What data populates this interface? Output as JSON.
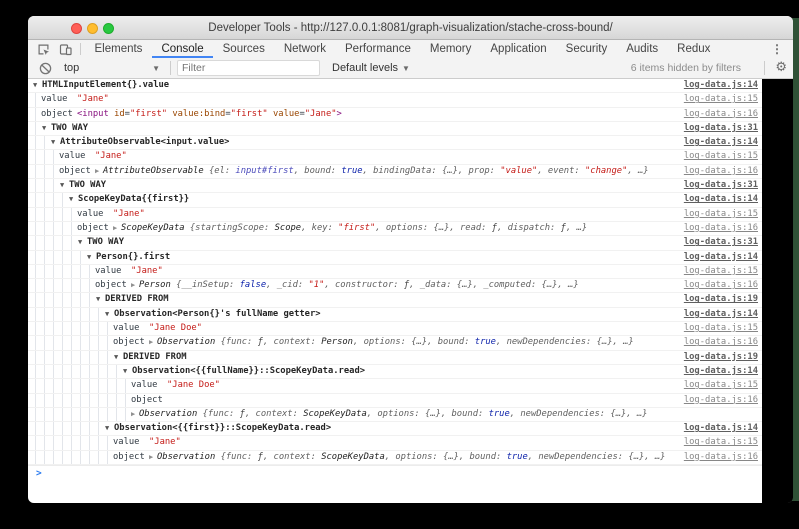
{
  "window": {
    "title": "Developer Tools - http://127.0.0.1:8081/graph-visualization/stache-cross-bound/"
  },
  "tabs": {
    "items": [
      "Elements",
      "Console",
      "Sources",
      "Network",
      "Performance",
      "Memory",
      "Application",
      "Security",
      "Audits",
      "Redux"
    ],
    "selected": "Console"
  },
  "toolbar": {
    "context_selector": "top",
    "filter_placeholder": "Filter",
    "levels_label": "Default levels",
    "hidden_info": "6 items hidden by filters"
  },
  "colors": {
    "accent_blue": "#4285f4",
    "string_red": "#c41a16",
    "boolean_blue": "#0d22aa",
    "tag_purple": "#881280",
    "attr_orange": "#994500",
    "element_ref_blue": "#4b4bbb",
    "edge_green": "#2f5136"
  },
  "console": {
    "prompt_symbol": ">",
    "rows": [
      {
        "level": 0,
        "type": "group",
        "segs": [
          {
            "t": "HTMLInputElement{}.value",
            "c": "g"
          }
        ],
        "link": "log-data.js:14"
      },
      {
        "level": 1,
        "type": "kv",
        "label": "value",
        "segs": [
          {
            "t": "\"Jane\"",
            "c": "str"
          }
        ],
        "link": "log-data.js:15"
      },
      {
        "level": 1,
        "type": "kv",
        "label": "object",
        "segs": [
          {
            "t": "<input ",
            "c": "tag"
          },
          {
            "t": "id",
            "c": "attr"
          },
          {
            "t": "=",
            "c": "p"
          },
          {
            "t": "\"first\"",
            "c": "aval"
          },
          {
            "t": " ",
            "c": "p"
          },
          {
            "t": "value:bind",
            "c": "attr"
          },
          {
            "t": "=",
            "c": "p"
          },
          {
            "t": "\"first\"",
            "c": "aval"
          },
          {
            "t": " ",
            "c": "p"
          },
          {
            "t": "value",
            "c": "attr"
          },
          {
            "t": "=",
            "c": "p"
          },
          {
            "t": "\"Jane\"",
            "c": "aval"
          },
          {
            "t": ">",
            "c": "tag"
          }
        ],
        "link": "log-data.js:16"
      },
      {
        "level": 1,
        "type": "group",
        "segs": [
          {
            "t": "TWO WAY",
            "c": "g"
          }
        ],
        "link": "log-data.js:31"
      },
      {
        "level": 2,
        "type": "group",
        "segs": [
          {
            "t": "AttributeObservable<input.value>",
            "c": "g"
          }
        ],
        "link": "log-data.js:14"
      },
      {
        "level": 3,
        "type": "kv",
        "label": "value",
        "segs": [
          {
            "t": "\"Jane\"",
            "c": "str"
          }
        ],
        "link": "log-data.js:15"
      },
      {
        "level": 3,
        "type": "kv",
        "label": "object",
        "arrow": true,
        "segs": [
          {
            "t": "AttributeObservable ",
            "c": "obj"
          },
          {
            "t": "{el: ",
            "c": "prev"
          },
          {
            "t": "input#first",
            "c": "elref"
          },
          {
            "t": ", bound: ",
            "c": "prev"
          },
          {
            "t": "true",
            "c": "bool"
          },
          {
            "t": ", bindingData: {…}, prop: ",
            "c": "prev"
          },
          {
            "t": "\"value\"",
            "c": "istr"
          },
          {
            "t": ", event: ",
            "c": "prev"
          },
          {
            "t": "\"change\"",
            "c": "istr"
          },
          {
            "t": ", …}",
            "c": "prev"
          }
        ],
        "link": "log-data.js:16"
      },
      {
        "level": 3,
        "type": "group",
        "segs": [
          {
            "t": "TWO WAY",
            "c": "g"
          }
        ],
        "link": "log-data.js:31"
      },
      {
        "level": 4,
        "type": "group",
        "segs": [
          {
            "t": "ScopeKeyData{{first}}",
            "c": "g"
          }
        ],
        "link": "log-data.js:14"
      },
      {
        "level": 5,
        "type": "kv",
        "label": "value",
        "segs": [
          {
            "t": "\"Jane\"",
            "c": "str"
          }
        ],
        "link": "log-data.js:15"
      },
      {
        "level": 5,
        "type": "kv",
        "label": "object",
        "arrow": true,
        "segs": [
          {
            "t": "ScopeKeyData ",
            "c": "obj"
          },
          {
            "t": "{startingScope: ",
            "c": "prev"
          },
          {
            "t": "Scope",
            "c": "obj"
          },
          {
            "t": ", key: ",
            "c": "prev"
          },
          {
            "t": "\"first\"",
            "c": "istr"
          },
          {
            "t": ", options: {…}, read: ",
            "c": "prev"
          },
          {
            "t": "ƒ",
            "c": "fn"
          },
          {
            "t": ", dispatch: ",
            "c": "prev"
          },
          {
            "t": "ƒ",
            "c": "fn"
          },
          {
            "t": ", …}",
            "c": "prev"
          }
        ],
        "link": "log-data.js:16"
      },
      {
        "level": 5,
        "type": "group",
        "segs": [
          {
            "t": "TWO WAY",
            "c": "g"
          }
        ],
        "link": "log-data.js:31"
      },
      {
        "level": 6,
        "type": "group",
        "segs": [
          {
            "t": "Person{}.first",
            "c": "g"
          }
        ],
        "link": "log-data.js:14"
      },
      {
        "level": 7,
        "type": "kv",
        "label": "value",
        "segs": [
          {
            "t": "\"Jane\"",
            "c": "str"
          }
        ],
        "link": "log-data.js:15"
      },
      {
        "level": 7,
        "type": "kv",
        "label": "object",
        "arrow": true,
        "segs": [
          {
            "t": "Person ",
            "c": "obj"
          },
          {
            "t": "{__inSetup: ",
            "c": "prev"
          },
          {
            "t": "false",
            "c": "bool"
          },
          {
            "t": ", _cid: ",
            "c": "prev"
          },
          {
            "t": "\"1\"",
            "c": "istr"
          },
          {
            "t": ", constructor: ",
            "c": "prev"
          },
          {
            "t": "ƒ",
            "c": "fn"
          },
          {
            "t": ", _data: {…}, _computed: {…}, …}",
            "c": "prev"
          }
        ],
        "link": "log-data.js:16"
      },
      {
        "level": 7,
        "type": "group",
        "segs": [
          {
            "t": "DERIVED FROM",
            "c": "g"
          }
        ],
        "link": "log-data.js:19"
      },
      {
        "level": 8,
        "type": "group",
        "segs": [
          {
            "t": "Observation<Person{}'s fullName getter>",
            "c": "g"
          }
        ],
        "link": "log-data.js:14"
      },
      {
        "level": 9,
        "type": "kv",
        "label": "value",
        "segs": [
          {
            "t": "\"Jane Doe\"",
            "c": "str"
          }
        ],
        "link": "log-data.js:15"
      },
      {
        "level": 9,
        "type": "kv",
        "label": "object",
        "arrow": true,
        "segs": [
          {
            "t": "Observation ",
            "c": "obj"
          },
          {
            "t": "{func: ",
            "c": "prev"
          },
          {
            "t": "ƒ",
            "c": "fn"
          },
          {
            "t": ", context: ",
            "c": "prev"
          },
          {
            "t": "Person",
            "c": "obj"
          },
          {
            "t": ", options: {…}, bound: ",
            "c": "prev"
          },
          {
            "t": "true",
            "c": "bool"
          },
          {
            "t": ", newDependencies: {…}, …}",
            "c": "prev"
          }
        ],
        "link": "log-data.js:16"
      },
      {
        "level": 9,
        "type": "group",
        "segs": [
          {
            "t": "DERIVED FROM",
            "c": "g"
          }
        ],
        "link": "log-data.js:19"
      },
      {
        "level": 10,
        "type": "group",
        "segs": [
          {
            "t": "Observation<{{fullName}}::ScopeKeyData.read>",
            "c": "g"
          }
        ],
        "link": "log-data.js:14"
      },
      {
        "level": 11,
        "type": "kv",
        "label": "value",
        "segs": [
          {
            "t": "\"Jane Doe\"",
            "c": "str"
          }
        ],
        "link": "log-data.js:15"
      },
      {
        "level": 11,
        "type": "kv",
        "label": "object",
        "segs": [],
        "link": "log-data.js:16"
      },
      {
        "level": 11,
        "type": "cont",
        "arrow": true,
        "segs": [
          {
            "t": "Observation ",
            "c": "obj"
          },
          {
            "t": "{func: ",
            "c": "prev"
          },
          {
            "t": "ƒ",
            "c": "fn"
          },
          {
            "t": ", context: ",
            "c": "prev"
          },
          {
            "t": "ScopeKeyData",
            "c": "obj"
          },
          {
            "t": ", options: {…}, bound: ",
            "c": "prev"
          },
          {
            "t": "true",
            "c": "bool"
          },
          {
            "t": ", newDependencies: {…}, …}",
            "c": "prev"
          }
        ]
      },
      {
        "level": 8,
        "type": "group",
        "segs": [
          {
            "t": "Observation<{{first}}::ScopeKeyData.read>",
            "c": "g"
          }
        ],
        "link": "log-data.js:14"
      },
      {
        "level": 9,
        "type": "kv",
        "label": "value",
        "segs": [
          {
            "t": "\"Jane\"",
            "c": "str"
          }
        ],
        "link": "log-data.js:15"
      },
      {
        "level": 9,
        "type": "kv",
        "label": "object",
        "arrow": true,
        "segs": [
          {
            "t": "Observation ",
            "c": "obj"
          },
          {
            "t": "{func: ",
            "c": "prev"
          },
          {
            "t": "ƒ",
            "c": "fn"
          },
          {
            "t": ", context: ",
            "c": "prev"
          },
          {
            "t": "ScopeKeyData",
            "c": "obj"
          },
          {
            "t": ", options: {…}, bound: ",
            "c": "prev"
          },
          {
            "t": "true",
            "c": "bool"
          },
          {
            "t": ", newDependencies: {…}, …}",
            "c": "prev"
          }
        ],
        "link": "log-data.js:16"
      }
    ]
  }
}
